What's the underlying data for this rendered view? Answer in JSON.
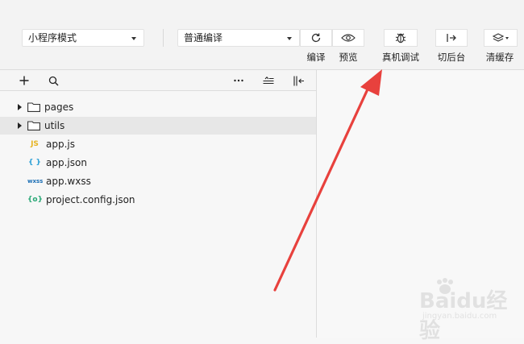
{
  "toolbar": {
    "mode_select": {
      "value": "小程序模式"
    },
    "compile_select": {
      "value": "普通编译"
    },
    "buttons": [
      {
        "label": "编译",
        "icon": "refresh-icon"
      },
      {
        "label": "预览",
        "icon": "eye-icon"
      },
      {
        "label": "真机调试",
        "icon": "bug-icon"
      },
      {
        "label": "切后台",
        "icon": "switch-background-icon"
      },
      {
        "label": "清缓存",
        "icon": "layers-icon"
      }
    ]
  },
  "filetree": {
    "header_icons": [
      "plus-icon",
      "search-icon",
      "more-icon",
      "collapse-icon",
      "sidebar-toggle-icon"
    ],
    "items": [
      {
        "name": "pages",
        "kind": "folder"
      },
      {
        "name": "utils",
        "kind": "folder",
        "selected": true
      },
      {
        "name": "app.js",
        "kind": "file",
        "badge": "JS",
        "badge_color": "#e6b422"
      },
      {
        "name": "app.json",
        "kind": "file",
        "badge": "{ }",
        "badge_color": "#2a9fd6"
      },
      {
        "name": "app.wxss",
        "kind": "file",
        "badge": "wxss",
        "badge_color": "#1c6fb5"
      },
      {
        "name": "project.config.json",
        "kind": "file",
        "badge": "{o}",
        "badge_color": "#2aa876"
      }
    ]
  },
  "annotation": {
    "arrow_color": "#e8413d"
  },
  "watermark": {
    "text": "Baidu经验",
    "sub": "jingyan.baidu.com"
  }
}
